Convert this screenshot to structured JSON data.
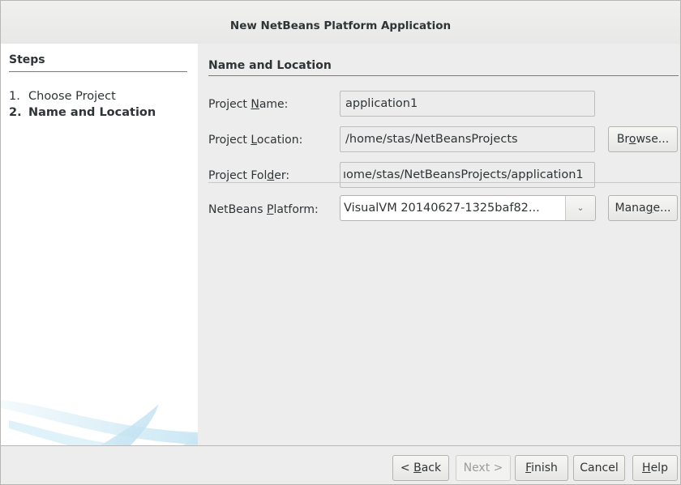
{
  "window": {
    "title": "New NetBeans Platform Application"
  },
  "steps": {
    "heading": "Steps",
    "items": [
      {
        "num": "1.",
        "label": "Choose Project"
      },
      {
        "num": "2.",
        "label": "Name and Location"
      }
    ],
    "current_index": 1
  },
  "panel": {
    "title": "Name and Location",
    "project_name": {
      "label_pre": "Project ",
      "label_mnemonic": "N",
      "label_post": "ame:",
      "value": "application1"
    },
    "project_location": {
      "label_pre": "Project ",
      "label_mnemonic": "L",
      "label_post": "ocation:",
      "value": "/home/stas/NetBeansProjects",
      "browse_pre": "Br",
      "browse_mnemonic": "o",
      "browse_post": "wse..."
    },
    "project_folder": {
      "label_pre": "Project Fol",
      "label_mnemonic": "d",
      "label_post": "er:",
      "value": "ıome/stas/NetBeansProjects/application1"
    },
    "platform": {
      "label_pre": "NetBeans ",
      "label_mnemonic": "P",
      "label_post": "latform:",
      "selected": "VisualVM 20140627-1325baf82...",
      "manage_pre": "Mana",
      "manage_mnemonic": "g",
      "manage_post": "e..."
    }
  },
  "buttons": {
    "back_pre": "< ",
    "back_mnemonic": "B",
    "back_post": "ack",
    "next": "Next >",
    "finish_mnemonic": "F",
    "finish_post": "inish",
    "cancel": "Cancel",
    "help_mnemonic": "H",
    "help_post": "elp"
  },
  "icons": {
    "arrow": "chevron-down-icon",
    "decoration": "netbeans-swoosh-decoration"
  },
  "colors": {
    "window_bg": "#ededed",
    "steps_bg": "#ffffff",
    "swoosh": "#b9dff0"
  }
}
